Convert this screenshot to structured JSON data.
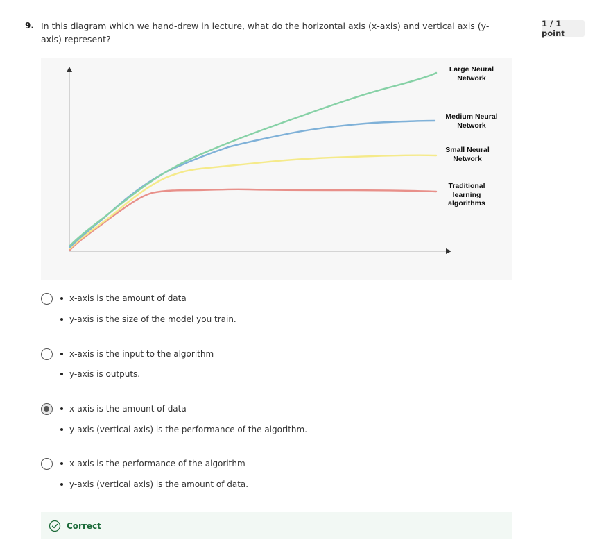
{
  "question": {
    "number": "9.",
    "text": "In this diagram which we hand-drew in lecture, what do the horizontal axis (x-axis) and vertical axis (y-axis) represent?",
    "score": "1 / 1 point"
  },
  "diagram": {
    "labels": {
      "large": "Large Neural Network",
      "medium": "Medium Neural Network",
      "small": "Small Neural Network",
      "traditional": "Traditional learning algorithms"
    },
    "colors": {
      "large": "#86d1a6",
      "medium": "#7fb1d8",
      "small": "#f5ea8a",
      "traditional": "#e8908a"
    }
  },
  "options": [
    {
      "line1": "x-axis is the amount of data",
      "line2": "y-axis is the size of the model you train.",
      "selected": false
    },
    {
      "line1": "x-axis is the input to the algorithm",
      "line2": "y-axis is outputs.",
      "selected": false
    },
    {
      "line1": "x-axis is the amount of data",
      "line2": "y-axis (vertical axis) is the performance of the algorithm.",
      "selected": true
    },
    {
      "line1": "x-axis is the performance of the algorithm",
      "line2": "y-axis (vertical axis) is the amount of data.",
      "selected": false
    }
  ],
  "feedback": {
    "label": "Correct",
    "icon": "check-circle-icon",
    "color": "#1d6b3a"
  }
}
